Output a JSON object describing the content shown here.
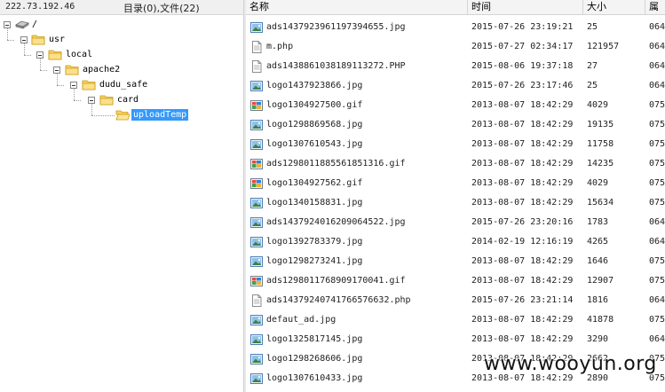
{
  "left_header": {
    "ip": "222.73.192.46",
    "stats": "目录(0),文件(22)"
  },
  "tree": [
    {
      "label": "/",
      "icon": "drive-icon"
    },
    {
      "label": "usr",
      "icon": "folder-icon"
    },
    {
      "label": "local",
      "icon": "folder-icon"
    },
    {
      "label": "apache2",
      "icon": "folder-icon"
    },
    {
      "label": "dudu_safe",
      "icon": "folder-icon"
    },
    {
      "label": "card",
      "icon": "folder-icon"
    },
    {
      "label": "uploadTemp",
      "icon": "folder-open-icon",
      "selected": true
    }
  ],
  "columns": {
    "name": "名称",
    "time": "时间",
    "size": "大小",
    "attr": "属"
  },
  "files": [
    {
      "name": "ads1437923961197394655.jpg",
      "time": "2015-07-26 23:19:21",
      "size": "25",
      "attr": "064",
      "icon": "image-file-icon"
    },
    {
      "name": "m.php",
      "time": "2015-07-27 02:34:17",
      "size": "121957",
      "attr": "064",
      "icon": "script-file-icon"
    },
    {
      "name": "ads1438861038189113272.PHP",
      "time": "2015-08-06 19:37:18",
      "size": "27",
      "attr": "064",
      "icon": "script-file-icon"
    },
    {
      "name": "logo1437923866.jpg",
      "time": "2015-07-26 23:17:46",
      "size": "25",
      "attr": "064",
      "icon": "image-file-icon"
    },
    {
      "name": "logo1304927500.gif",
      "time": "2013-08-07 18:42:29",
      "size": "4029",
      "attr": "075",
      "icon": "gif-file-icon"
    },
    {
      "name": "logo1298869568.jpg",
      "time": "2013-08-07 18:42:29",
      "size": "19135",
      "attr": "075",
      "icon": "image-file-icon"
    },
    {
      "name": "logo1307610543.jpg",
      "time": "2013-08-07 18:42:29",
      "size": "11758",
      "attr": "075",
      "icon": "image-file-icon"
    },
    {
      "name": "ads1298011885561851316.gif",
      "time": "2013-08-07 18:42:29",
      "size": "14235",
      "attr": "075",
      "icon": "gif-file-icon"
    },
    {
      "name": "logo1304927562.gif",
      "time": "2013-08-07 18:42:29",
      "size": "4029",
      "attr": "075",
      "icon": "gif-file-icon"
    },
    {
      "name": "logo1340158831.jpg",
      "time": "2013-08-07 18:42:29",
      "size": "15634",
      "attr": "075",
      "icon": "image-file-icon"
    },
    {
      "name": "ads1437924016209064522.jpg",
      "time": "2015-07-26 23:20:16",
      "size": "1783",
      "attr": "064",
      "icon": "image-file-icon"
    },
    {
      "name": "logo1392783379.jpg",
      "time": "2014-02-19 12:16:19",
      "size": "4265",
      "attr": "064",
      "icon": "image-file-icon"
    },
    {
      "name": "logo1298273241.jpg",
      "time": "2013-08-07 18:42:29",
      "size": "1646",
      "attr": "075",
      "icon": "image-file-icon"
    },
    {
      "name": "ads1298011768909170041.gif",
      "time": "2013-08-07 18:42:29",
      "size": "12907",
      "attr": "075",
      "icon": "gif-file-icon"
    },
    {
      "name": "ads1437924074176657663​2.php",
      "time": "2015-07-26 23:21:14",
      "size": "1816",
      "attr": "064",
      "icon": "script-file-icon"
    },
    {
      "name": "defaut_ad.jpg",
      "time": "2013-08-07 18:42:29",
      "size": "41878",
      "attr": "075",
      "icon": "image-file-icon"
    },
    {
      "name": "logo1325817145.jpg",
      "time": "2013-08-07 18:42:29",
      "size": "3290",
      "attr": "064",
      "icon": "image-file-icon"
    },
    {
      "name": "logo1298268606.jpg",
      "time": "2013-08-07 18:42:29",
      "size": "2662",
      "attr": "075",
      "icon": "image-file-icon"
    },
    {
      "name": "logo1307610433.jpg",
      "time": "2013-08-07 18:42:29",
      "size": "2890",
      "attr": "075",
      "icon": "image-file-icon"
    }
  ],
  "watermark": "www.wooyun.org",
  "colors": {
    "selection": "#3399ff",
    "folder": "#f5c542",
    "header_bg": "#f4f4f4"
  }
}
